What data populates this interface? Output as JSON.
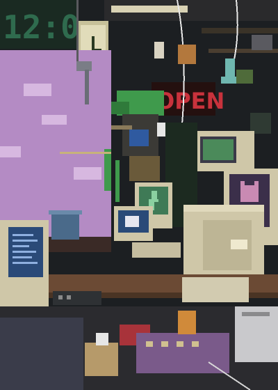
{
  "scene": {
    "clock_display": "12:0",
    "neon_sign": "OPEN",
    "colors": {
      "wall_dark": "#1a1c1e",
      "window_sky": "#b48bc4",
      "cloud": "#d7b8e0",
      "crt_beige": "#cfc7a8",
      "crt_shadow": "#8f876c",
      "screen_green": "#3f7a56",
      "screen_blue": "#2a4a78",
      "neon_red": "#c8323c",
      "plant_green": "#3f9a4c",
      "desk_wood": "#6b4a34",
      "floor": "#2b2b2f"
    },
    "icons": [
      "wall-clock-icon",
      "phone-handset-icon",
      "lightning-bolt-icon",
      "cat-face-icon",
      "bucket-icon"
    ]
  }
}
